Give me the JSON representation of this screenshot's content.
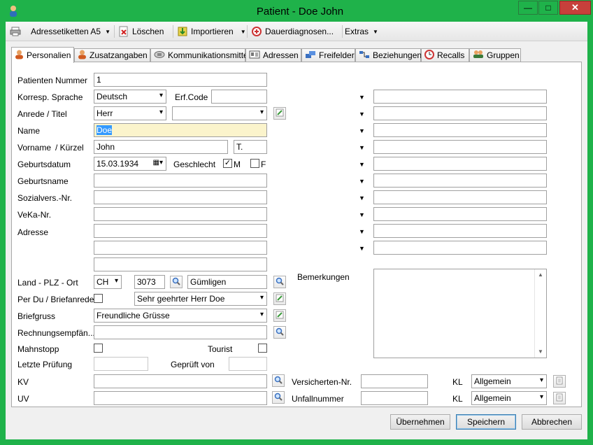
{
  "window": {
    "title": "Patient - Doe John",
    "minimize": "—",
    "maximize": "□",
    "close": "✕"
  },
  "toolbar": {
    "print_icon": "printer-icon",
    "address_labels": "Adressetiketten A5",
    "delete": "Löschen",
    "import": "Importieren",
    "diagnoses": "Dauerdiagnosen...",
    "extras": "Extras"
  },
  "tabs": [
    {
      "label": "Personalien",
      "icon": "person-icon"
    },
    {
      "label": "Zusatzangaben",
      "icon": "person-icon"
    },
    {
      "label": "Kommunikationsmittel",
      "icon": "phone-icon"
    },
    {
      "label": "Adressen",
      "icon": "card-icon"
    },
    {
      "label": "Freifelder",
      "icon": "fields-icon"
    },
    {
      "label": "Beziehungen",
      "icon": "relation-icon"
    },
    {
      "label": "Recalls",
      "icon": "clock-icon"
    },
    {
      "label": "Gruppen",
      "icon": "group-icon"
    }
  ],
  "form": {
    "patient_number_label": "Patienten Nummer",
    "patient_number": "1",
    "language_label": "Korresp. Sprache",
    "language": "Deutsch",
    "erf_code_label": "Erf.Code",
    "erf_code": "",
    "salutation_label": "Anrede / Titel",
    "salutation": "Herr",
    "title_value": "",
    "name_label": "Name",
    "name": "Doe",
    "firstname_label": "Vorname",
    "short_label": "/ Kürzel",
    "firstname": "John",
    "short": "T.",
    "birthdate_label": "Geburtsdatum",
    "birthdate": "15.03.1934",
    "gender_label": "Geschlecht",
    "gender_m": "M",
    "gender_f": "F",
    "birthname_label": "Geburtsname",
    "social_label": "Sozialvers.-Nr.",
    "veka_label": "VeKa-Nr.",
    "address_label": "Adresse",
    "country_label": "Land - PLZ - Ort",
    "country": "CH",
    "zip": "3073",
    "city": "Gümligen",
    "perdu_label": "Per Du / Briefanrede",
    "letter_salutation": "Sehr geehrter Herr Doe",
    "briefgruss_label": "Briefgruss",
    "briefgruss": "Freundliche Grüsse",
    "billing_label": "Rechnungsempfän...",
    "mahnstopp_label": "Mahnstopp",
    "tourist_label": "Tourist",
    "last_check_label": "Letzte Prüfung",
    "checked_by_label": "Geprüft von",
    "kv_label": "KV",
    "uv_label": "UV",
    "insured_nr_label": "Versicherten-Nr.",
    "accident_nr_label": "Unfallnummer",
    "kl_label": "KL",
    "kl_kv": "Allgemein",
    "kl_uv": "Allgemein",
    "remarks_label": "Bemerkungen"
  },
  "buttons": {
    "apply": "Übernehmen",
    "save": "Speichern",
    "cancel": "Abbrechen"
  }
}
